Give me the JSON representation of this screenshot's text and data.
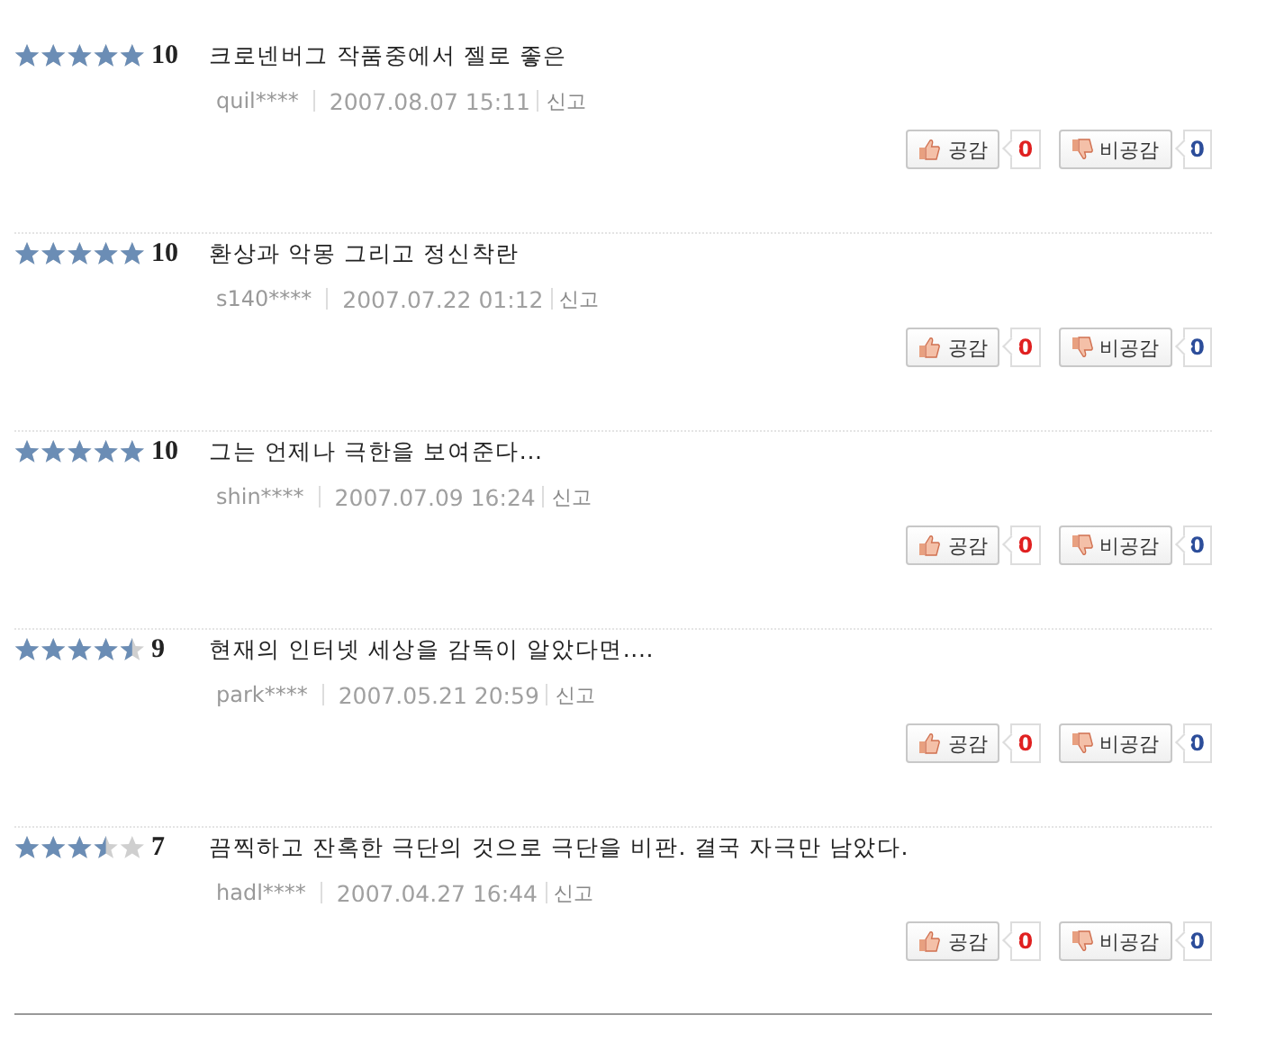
{
  "reviews": [
    {
      "stars": 5,
      "score": "10",
      "text": "크로넨버그 작품중에서 젤로 좋은",
      "user": "quil****",
      "date": "2007.08.07 15:11",
      "report": "신고",
      "agree_label": "공감",
      "agree_count": "0",
      "disagree_label": "비공감",
      "disagree_count": "0"
    },
    {
      "stars": 5,
      "score": "10",
      "text": "환상과 악몽 그리고 정신착란",
      "user": "s140****",
      "date": "2007.07.22 01:12",
      "report": "신고",
      "agree_label": "공감",
      "agree_count": "0",
      "disagree_label": "비공감",
      "disagree_count": "0"
    },
    {
      "stars": 5,
      "score": "10",
      "text": "그는 언제나 극한을 보여준다...",
      "user": "shin****",
      "date": "2007.07.09 16:24",
      "report": "신고",
      "agree_label": "공감",
      "agree_count": "0",
      "disagree_label": "비공감",
      "disagree_count": "0"
    },
    {
      "stars": 4.5,
      "score": "9",
      "text": "현재의 인터넷 세상을 감독이 알았다면....",
      "user": "park****",
      "date": "2007.05.21 20:59",
      "report": "신고",
      "agree_label": "공감",
      "agree_count": "0",
      "disagree_label": "비공감",
      "disagree_count": "0"
    },
    {
      "stars": 3.5,
      "score": "7",
      "text": "끔찍하고 잔혹한 극단의 것으로 극단을 비판. 결국 자극만 남았다.",
      "user": "hadl****",
      "date": "2007.04.27 16:44",
      "report": "신고",
      "agree_label": "공감",
      "agree_count": "0",
      "disagree_label": "비공감",
      "disagree_count": "0"
    }
  ]
}
